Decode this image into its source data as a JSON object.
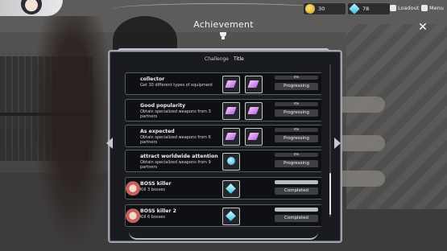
{
  "header": {
    "title": "Achievement",
    "tabs": [
      {
        "label": "Challenge",
        "active": false
      },
      {
        "label": "Title",
        "active": true
      }
    ]
  },
  "topbar": {
    "gold": "30",
    "gems": "78",
    "loadout_label": "Loadout",
    "menu_label": "Menu"
  },
  "achievements": [
    {
      "name": "collector",
      "desc": "Get 30 different types of equipment",
      "progress_text": "0%",
      "progress": 0,
      "status": "Progressing",
      "rewards": [
        "purple-crystal-icon",
        "purple-crystal-icon"
      ]
    },
    {
      "name": "Good popularity",
      "desc": "Obtain specialized weapons from 3 partners",
      "progress_text": "0%",
      "progress": 0,
      "status": "Progressing",
      "rewards": [
        "purple-crystal-icon",
        "purple-crystal-icon"
      ]
    },
    {
      "name": "As expected",
      "desc": "Obtain specialized weapons from 6 partners",
      "progress_text": "0%",
      "progress": 0,
      "status": "Progressing",
      "rewards": [
        "purple-crystal-icon",
        "purple-crystal-icon"
      ]
    },
    {
      "name": "attract worldwide attention",
      "desc": "Obtain specialized weapons from 9 partners",
      "progress_text": "0%",
      "progress": 0,
      "status": "Progressing",
      "rewards": [
        "blue-orb-icon"
      ]
    },
    {
      "name": "BOSS killer",
      "desc": "Kill 3 bosses",
      "progress_text": "",
      "progress": 1,
      "status": "Completed",
      "rewards": [
        "blue-crystal-icon"
      ]
    },
    {
      "name": "BOSS killer 2",
      "desc": "Kill 6 bosses",
      "progress_text": "",
      "progress": 1,
      "status": "Completed",
      "rewards": [
        "blue-crystal-icon"
      ]
    }
  ]
}
